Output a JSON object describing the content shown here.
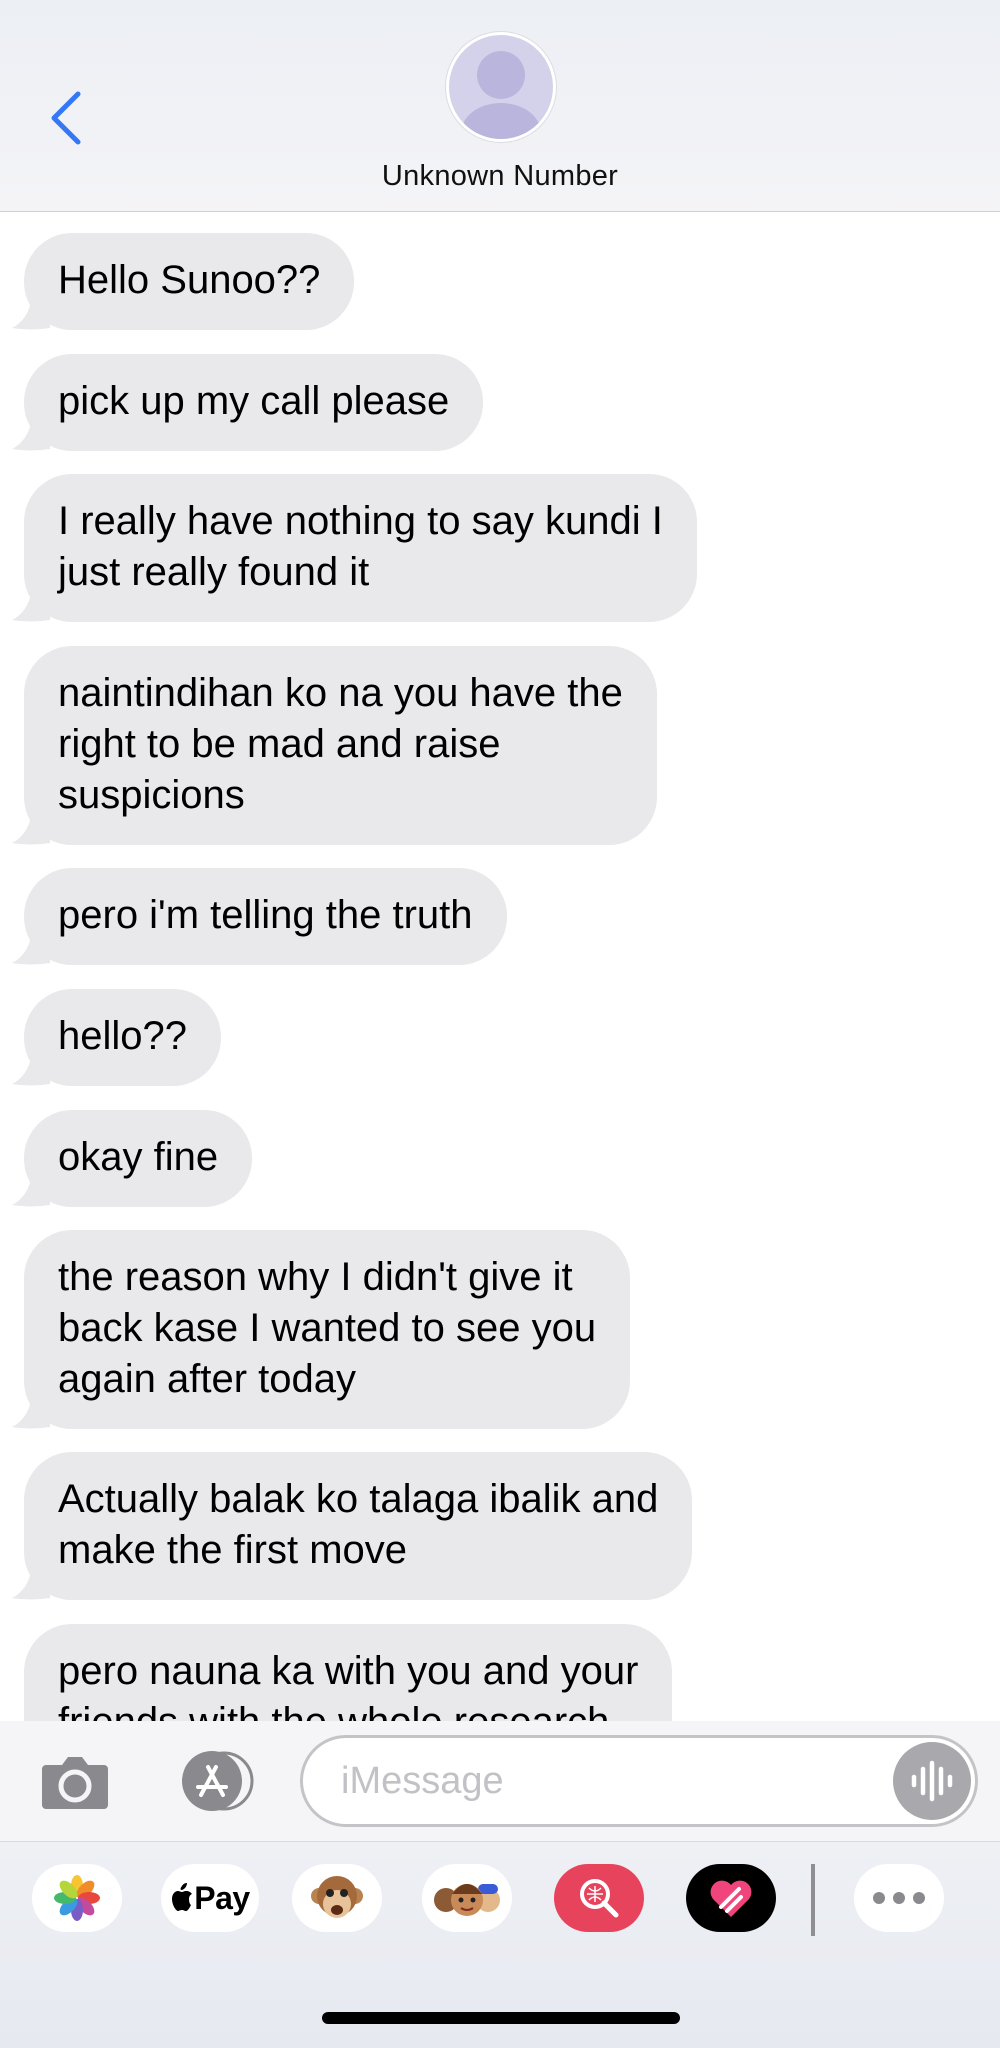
{
  "header": {
    "contact_name": "Unknown Number",
    "back_icon": "chevron-left-icon",
    "accent_color": "#3478f6"
  },
  "messages": [
    {
      "lines": [
        "Hello Sunoo??"
      ]
    },
    {
      "lines": [
        "pick up my call please"
      ]
    },
    {
      "lines": [
        "I really have nothing to say kundi I",
        "just really found it"
      ]
    },
    {
      "lines": [
        "naintindihan ko na you have the",
        "right to be mad and raise",
        "suspicions"
      ]
    },
    {
      "lines": [
        "pero i'm telling the truth"
      ]
    },
    {
      "lines": [
        "hello??"
      ]
    },
    {
      "lines": [
        "okay fine"
      ]
    },
    {
      "lines": [
        "the reason why I didn't give it",
        "back kase I wanted to see you",
        "again after today"
      ]
    },
    {
      "lines": [
        "Actually balak ko talaga ibalik and",
        "make the first move"
      ]
    },
    {
      "lines": [
        "pero nauna ka with you and your",
        "friends with the whole research"
      ]
    }
  ],
  "input_bar": {
    "placeholder": "iMessage",
    "camera_icon": "camera-icon",
    "apps_icon": "app-store-icon",
    "voice_icon": "waveform-icon"
  },
  "drawer": {
    "apps": [
      {
        "name": "photos-icon"
      },
      {
        "name": "apple-pay-icon",
        "label": "Pay"
      },
      {
        "name": "animoji-icon"
      },
      {
        "name": "memoji-icon"
      },
      {
        "name": "images-search-icon"
      },
      {
        "name": "digital-touch-icon"
      },
      {
        "name": "more-icon"
      }
    ]
  },
  "colors": {
    "incoming_bubble": "#e9e9ec",
    "search_red": "#e8435c"
  }
}
